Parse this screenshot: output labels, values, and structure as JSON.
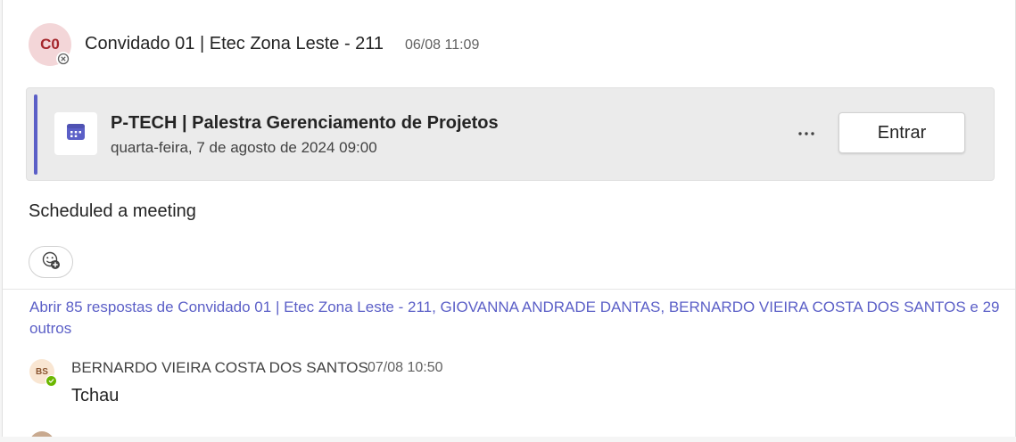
{
  "post": {
    "avatar_initials": "C0",
    "sender": "Convidado 01 | Etec Zona Leste - 211",
    "timestamp": "06/08 11:09",
    "presence_icon": "blocked-icon",
    "message": "Scheduled a meeting",
    "reaction_icon": "add-reaction-icon"
  },
  "meeting": {
    "icon": "calendar-icon",
    "title": "P-TECH | Palestra Gerenciamento de Projetos",
    "datetime": "quarta-feira, 7 de agosto de 2024 09:00",
    "more_label": "···",
    "join_label": "Entrar"
  },
  "thread": {
    "replies_link": "Abrir 85 respostas de Convidado 01 | Etec Zona Leste - 211, GIOVANNA ANDRADE DANTAS, BERNARDO VIEIRA COSTA DOS SANTOS e 29 outros"
  },
  "reply": {
    "avatar_initials": "BS",
    "sender": "BERNARDO VIEIRA COSTA DOS SANTOS",
    "timestamp": "07/08 10:50",
    "text": "Tchau",
    "presence_icon": "available-icon"
  },
  "colors": {
    "accent": "#5b5fc7",
    "link": "#5b5fc7",
    "presence_available": "#6bb700",
    "avatar_main_bg": "#f3d6d8",
    "avatar_main_fg": "#a4262c",
    "avatar_reply_bg": "#f9e6d2"
  }
}
